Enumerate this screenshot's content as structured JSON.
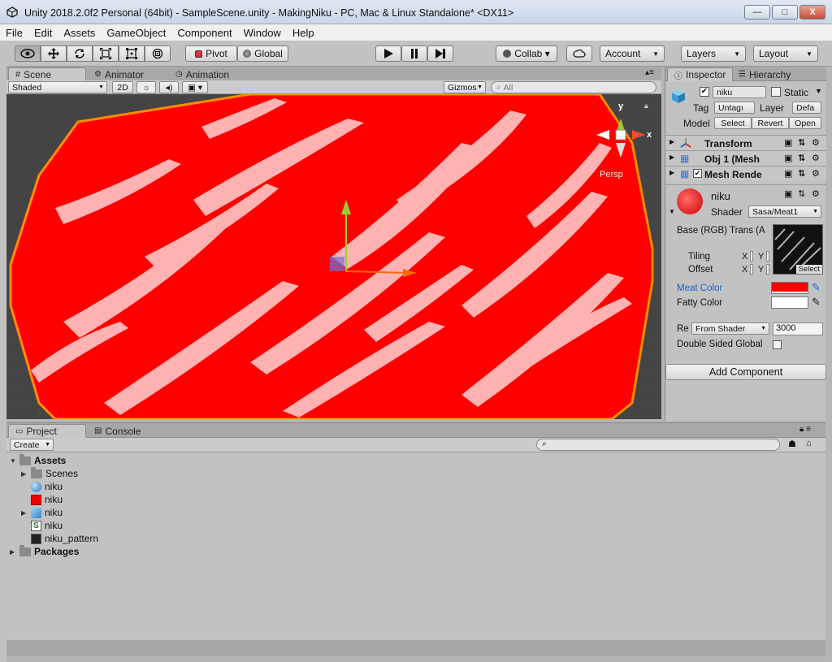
{
  "window": {
    "title": "Unity 2018.2.0f2 Personal (64bit) - SampleScene.unity - MakingNiku - PC, Mac & Linux Standalone* <DX11>",
    "minimize": "—",
    "maximize": "□",
    "close": "X"
  },
  "menu": [
    "File",
    "Edit",
    "Assets",
    "GameObject",
    "Component",
    "Window",
    "Help"
  ],
  "toolbar": {
    "pivot": "Pivot",
    "global": "Global",
    "collab": "Collab ▾",
    "account": "Account",
    "layers": "Layers",
    "layout": "Layout"
  },
  "scene": {
    "tabs": [
      "Scene",
      "Animator",
      "Animation"
    ],
    "shading": "Shaded",
    "mode_2d": "2D",
    "gizmos": "Gizmos",
    "search_placeholder": "All",
    "persp": "Persp",
    "axis_y": "y",
    "axis_x": "x"
  },
  "inspector": {
    "tabs": [
      "Inspector",
      "Hierarchy"
    ],
    "object_name": "niku",
    "static_label": "Static",
    "tag_label": "Tag",
    "tag_value": "Untagı",
    "layer_label": "Layer",
    "layer_value": "Defa",
    "model_label": "Model",
    "model_buttons": [
      "Select",
      "Revert",
      "Open"
    ],
    "components": [
      "Transform",
      "Obj 1 (Mesh",
      "Mesh Rende"
    ],
    "material_name": "niku",
    "shader_label": "Shader",
    "shader_value": "Sasa/Meat1",
    "base_label": "Base (RGB) Trans (A",
    "tiling_label": "Tiling",
    "offset_label": "Offset",
    "x_label": "X",
    "y_label": "Y",
    "select_label": "Select",
    "meat_color_label": "Meat Color",
    "fatty_color_label": "Fatty Color",
    "render_queue_label": "Re",
    "render_queue_mode": "From Shader",
    "render_queue_value": "3000",
    "double_sided_label": "Double Sided Global",
    "add_component": "Add Component",
    "meat_color": "#ff0000",
    "fatty_color": "#ffffff"
  },
  "project": {
    "tabs": [
      "Project",
      "Console"
    ],
    "create": "Create",
    "tree": [
      {
        "label": "Assets",
        "bold": true,
        "icon": "folder-icon"
      },
      {
        "label": "Scenes",
        "bold": false,
        "icon": "folder-icon"
      },
      {
        "label": "niku",
        "bold": false,
        "icon": "sphere-icon"
      },
      {
        "label": "niku",
        "bold": false,
        "icon": "material-icon"
      },
      {
        "label": "niku",
        "bold": false,
        "icon": "prefab-icon"
      },
      {
        "label": "niku",
        "bold": false,
        "icon": "shader-icon"
      },
      {
        "label": "niku_pattern",
        "bold": false,
        "icon": "texture-icon"
      },
      {
        "label": "Packages",
        "bold": true,
        "icon": "folder-icon"
      }
    ]
  },
  "colors": {
    "meat": "#ff0000",
    "meat_outline": "#ff8c00",
    "fat": "#ffd9d9"
  }
}
